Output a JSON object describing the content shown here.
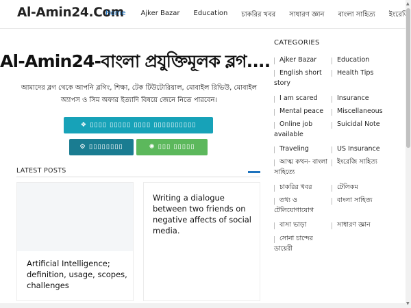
{
  "site": {
    "logo": "Al-Amin24.Com"
  },
  "nav": {
    "items": [
      {
        "label": "Home"
      },
      {
        "label": "Ajker Bazar"
      },
      {
        "label": "Education"
      },
      {
        "label": "চাকরির খবর"
      },
      {
        "label": "সাধারণ জ্ঞান"
      },
      {
        "label": "বাংলা সাহিত্য"
      },
      {
        "label": "ইংরেজি সাহিত্য"
      }
    ]
  },
  "hero": {
    "title": "Al-Amin24-বাংলা প্রযুক্তিমূলক ব্লগ....",
    "description": "আমাদের ব্লগ থেকে আপনি ব্লগিং, শিক্ষা, টেক টিউটোরিয়াল, মোবাইল রিভিউ, মোবাইল অ্যাপস ও সিম অফার ইত্যাদি বিষয়ে জেনে নিতে পারবেন।"
  },
  "latest": {
    "label": "LATEST POSTS",
    "posts": [
      {
        "title": "Artificial Intelligence; definition, usage, scopes, challenges"
      },
      {
        "title": "Writing a dialogue between two friends on negative affects of social media."
      }
    ]
  },
  "sidebar": {
    "title": "CATEGORIES",
    "categories": [
      {
        "label": "Ajker Bazar"
      },
      {
        "label": "Education"
      },
      {
        "label": "English short story"
      },
      {
        "label": "Health Tips"
      },
      {
        "label": "I am scared"
      },
      {
        "label": "Insurance"
      },
      {
        "label": "Mental peace"
      },
      {
        "label": "Miscellaneous"
      },
      {
        "label": "Online job available"
      },
      {
        "label": "Suicidal Note"
      },
      {
        "label": "Traveling"
      },
      {
        "label": "US Insurance"
      },
      {
        "label": "আত্ম কথন- বাংলা সাহিত্যে"
      },
      {
        "label": "ইংরেজি সাহিত্য"
      },
      {
        "label": "চাকরির খবর"
      },
      {
        "label": "টেলিকম"
      },
      {
        "label": "তথ্য ও টেলিযোগাযোগ"
      },
      {
        "label": "বাংলা সাহিত্য"
      },
      {
        "label": "বাসা ভাড়া"
      },
      {
        "label": "সাধারণ জ্ঞান"
      },
      {
        "label": "সোনা চান্দের ডায়েরী"
      }
    ]
  },
  "colors": {
    "accent": "#1e73be",
    "button_main": "#17a2b8",
    "button_secondary": "#1a7c91",
    "button_green": "#5cb85c"
  },
  "icons": [
    "hamburger-icon"
  ]
}
